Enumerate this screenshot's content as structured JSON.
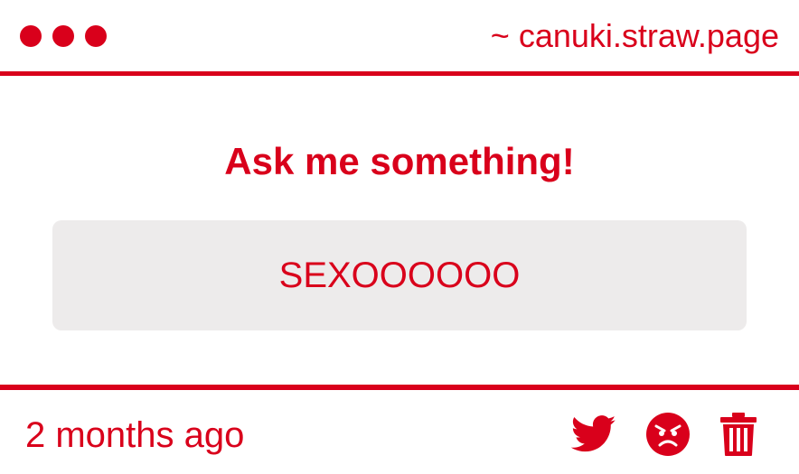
{
  "header": {
    "title": "~ canuki.straw.page",
    "window_controls": [
      "dot",
      "dot",
      "dot"
    ]
  },
  "main": {
    "prompt": "Ask me something!",
    "question": "SEXOOOOOO"
  },
  "footer": {
    "timestamp": "2 months ago",
    "actions": [
      {
        "icon": "twitter-icon"
      },
      {
        "icon": "angry-face-icon"
      },
      {
        "icon": "trash-icon"
      }
    ]
  },
  "colors": {
    "accent": "#d9001b",
    "box_background": "#edebeb",
    "page_background": "#ffffff"
  }
}
